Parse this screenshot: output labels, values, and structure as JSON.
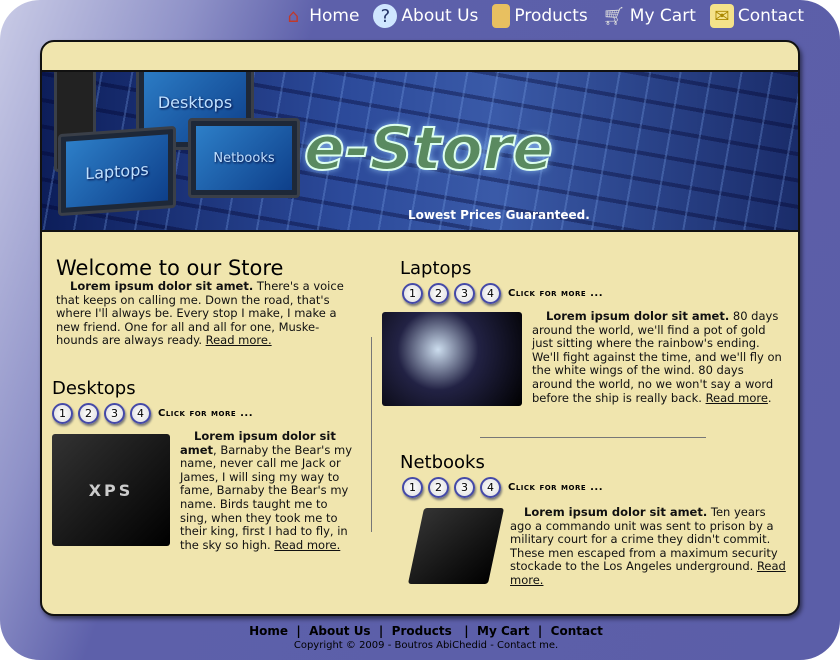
{
  "nav": [
    {
      "label": "Home",
      "icon": "home-icon"
    },
    {
      "label": "About Us",
      "icon": "question-icon"
    },
    {
      "label": "Products",
      "icon": "folder-icon"
    },
    {
      "label": "My Cart",
      "icon": "cart-icon"
    },
    {
      "label": "Contact",
      "icon": "envelope-icon"
    }
  ],
  "banner": {
    "logo": "e-Store",
    "tagline": "Lowest Prices Guaranteed.",
    "devices": [
      "Desktops",
      "Laptops",
      "Netbooks"
    ]
  },
  "welcome": {
    "title": "Welcome to our Store",
    "lead": "Lorem ipsum dolor sit amet.",
    "text": " There's a voice that keeps on calling me. Down the road, that's where I'll always be. Every stop I make, I make a new friend.  One for all and all for one, Muske-hounds are always ready.  ",
    "more": "Read more."
  },
  "sections": [
    {
      "title": "Desktops",
      "pages": [
        "1",
        "2",
        "3",
        "4"
      ],
      "click": "Click for more ...",
      "lead": "Lorem ipsum dolor sit amet",
      "text": ", Barnaby the Bear's my name, never call me Jack or James, I will sing my way to fame, Barnaby the Bear's my name. Birds taught me to sing, when they took me to their king, first I had to fly, in the sky so high.  ",
      "more": "Read more.",
      "image_label": "XPS"
    },
    {
      "title": "Laptops",
      "pages": [
        "1",
        "2",
        "3",
        "4"
      ],
      "click": "Click for more ...",
      "lead": "Lorem ipsum dolor sit amet.",
      "text": " 80 days around the world, we'll find a pot of gold just sitting where the rainbow's ending. We'll fight against the time, and we'll fly on the white wings of the wind. 80 days around the world, no we won't say a word before the ship is really back.  ",
      "more": "Read more"
    },
    {
      "title": "Netbooks",
      "pages": [
        "1",
        "2",
        "3",
        "4"
      ],
      "click": "Click for more ...",
      "lead": "Lorem ipsum dolor sit amet.",
      "text": " Ten years ago a commando unit was sent to prison by a military court for a crime they didn't commit. These men escaped from a maximum security stockade to the Los Angeles underground. ",
      "more": "Read more."
    }
  ],
  "footer": {
    "links": [
      "Home",
      "About Us",
      "Products",
      "My Cart",
      "Contact"
    ],
    "copyright": "Copyright © 2009 - Boutros  AbiChedid - Contact me."
  },
  "colors": {
    "frame": "#5b5ea8",
    "panel": "#f0e5ae",
    "pager_ring": "#4449a8"
  }
}
